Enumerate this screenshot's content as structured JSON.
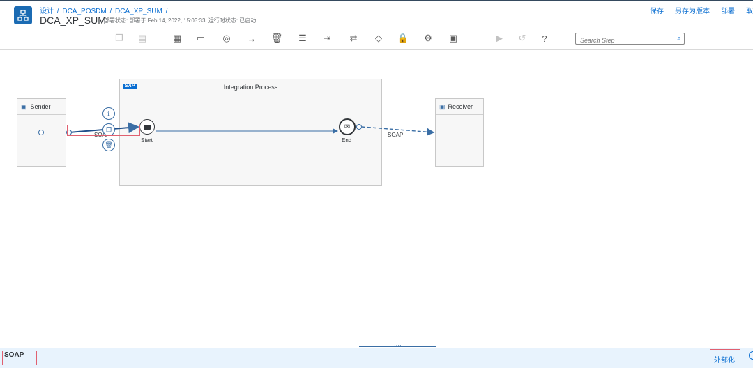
{
  "header": {
    "breadcrumb": [
      "设计",
      "DCA_POSDM",
      "DCA_XP_SUM"
    ],
    "breadcrumb_sep": "/",
    "title": "DCA_XP_SUM",
    "status": "部署状态: 部署于 Feb 14, 2022, 15:03:33,  运行时状态: 已启动",
    "actions": [
      "保存",
      "另存为版本",
      "部署",
      "取"
    ]
  },
  "toolbar": {
    "search_placeholder": "Search Step",
    "icons": [
      "copy-icon",
      "paste-icon",
      "clipboard-add-icon",
      "window-icon",
      "target-icon",
      "arrow-right-icon",
      "delete-icon",
      "menu-icon",
      "exit-icon",
      "switch-icon",
      "gateway-icon",
      "lock-icon",
      "gear-icon",
      "clipboard-icon",
      "play-icon",
      "undo-icon",
      "help-icon"
    ]
  },
  "diagram": {
    "sender_label": "Sender",
    "receiver_label": "Receiver",
    "process_label": "Integration Process",
    "sap_logo": "SAP",
    "start_label": "Start",
    "end_label": "End",
    "edge_in_label": "SOAP",
    "edge_out_label": "SOAP"
  },
  "footer": {
    "left_label": "SOAP",
    "right_label": "外部化",
    "handle": "····"
  },
  "colors": {
    "accent": "#0a6ed1",
    "flow": "#3a6ea5",
    "highlight": "#e06070"
  }
}
